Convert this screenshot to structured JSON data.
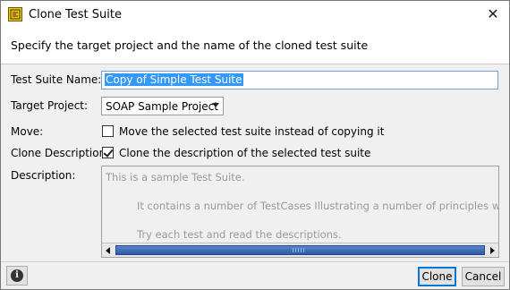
{
  "window": {
    "title": "Clone Test Suite"
  },
  "header": {
    "text": "Specify the target project and the name of the cloned test suite"
  },
  "form": {
    "name_label": "Test Suite Name:",
    "name_value": "Copy of Simple Test Suite",
    "project_label": "Target Project:",
    "project_value": "SOAP Sample Project",
    "move_label": "Move:",
    "move_text": "Move the selected test suite instead of copying it",
    "move_checked": false,
    "clone_desc_label": "Clone Description:",
    "clone_desc_text": "Clone the description of the selected test suite",
    "clone_desc_checked": true,
    "description_label": "Description:",
    "description_lines": [
      "This is a sample Test Suite.",
      "It contains a number of TestCases Illustrating a number of principles with Soa",
      "Try each test and read the descriptions."
    ]
  },
  "buttons": {
    "clone": "Clone",
    "cancel": "Cancel"
  },
  "icons": {
    "app": "soapui-icon",
    "info": "i"
  }
}
